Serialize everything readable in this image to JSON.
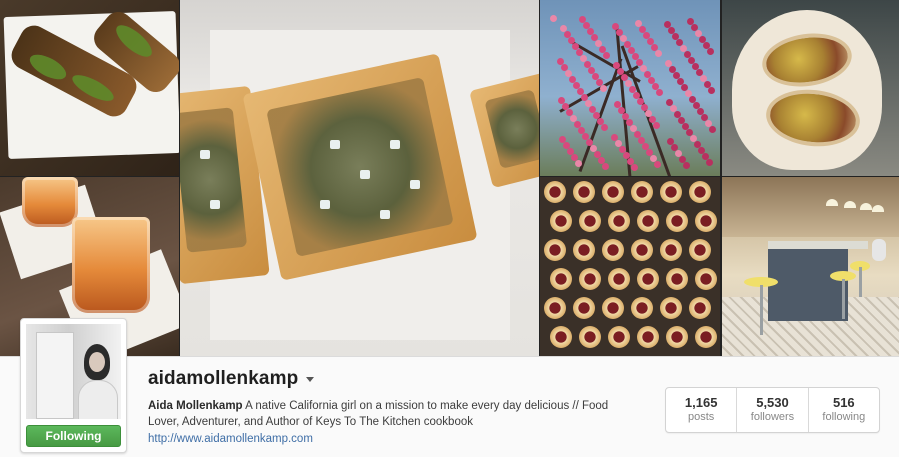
{
  "profile": {
    "username": "aidamollenkamp",
    "full_name": "Aida Mollenkamp",
    "bio_text": "A native California girl on a mission to make every day delicious // Food Lover, Adventurer, and Author of Keys To The Kitchen cookbook",
    "website": "http://www.aidamollenkamp.com",
    "follow_button_label": "Following",
    "follow_button_color": "#5cb85c"
  },
  "stats": [
    {
      "value": "1,165",
      "label": "posts"
    },
    {
      "value": "5,530",
      "label": "followers"
    },
    {
      "value": "516",
      "label": "following"
    }
  ],
  "photos": [
    {
      "subject": "toast-with-arugula"
    },
    {
      "subject": "iced-cocktail"
    },
    {
      "subject": "blue-cheese-tart"
    },
    {
      "subject": "pink-blossoms"
    },
    {
      "subject": "wrapped-sandwich"
    },
    {
      "subject": "mini-tarts"
    },
    {
      "subject": "diner-counter"
    }
  ]
}
